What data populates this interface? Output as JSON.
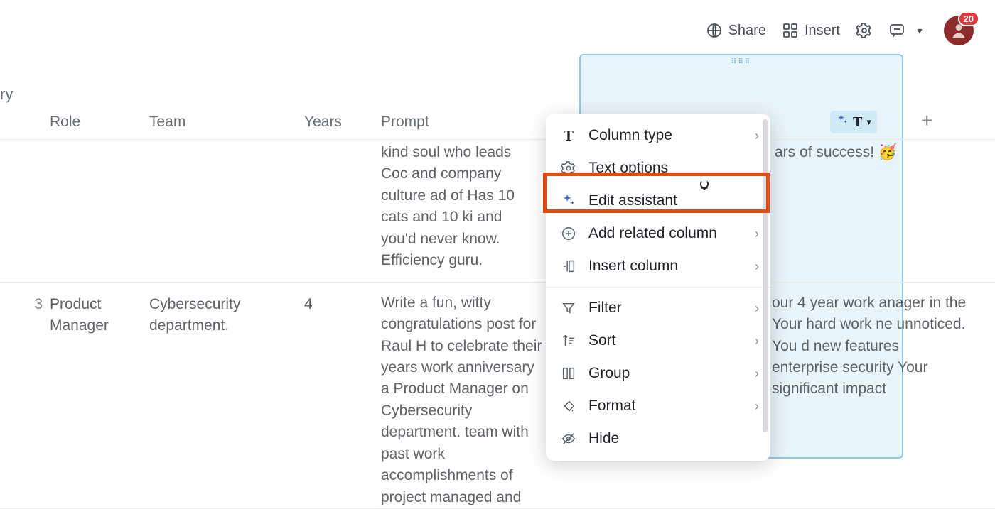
{
  "topbar": {
    "share": "Share",
    "insert": "Insert",
    "notification_count": "20"
  },
  "breadcrumb_fragment": "ry",
  "columns": {
    "role": "Role",
    "team": "Team",
    "years": "Years",
    "prompt": "Prompt"
  },
  "rows": [
    {
      "id_fragment": "",
      "role": "",
      "team": "",
      "years": "",
      "prompt": "kind soul who leads Coc and company culture ad of Has 10 cats and 10 ki and you'd never know. Efficiency guru.",
      "output": "ars of success! 🥳"
    },
    {
      "id_fragment": "3",
      "role": "Product Manager",
      "team": "Cybersecurity department.",
      "years": "4",
      "prompt": "Write a fun, witty congratulations post for Raul H to celebrate their years work anniversary a Product Manager on Cybersecurity department. team with past work accomplishments of project managed and",
      "output": "our 4 year work anager in the Your hard work ne unnoticed. You d new features enterprise security Your significant impact"
    }
  ],
  "menu": {
    "column_type": "Column type",
    "text_options": "Text options",
    "edit_assistant": "Edit assistant",
    "add_related_column": "Add related column",
    "insert_column": "Insert column",
    "filter": "Filter",
    "sort": "Sort",
    "group": "Group",
    "format": "Format",
    "hide": "Hide"
  }
}
